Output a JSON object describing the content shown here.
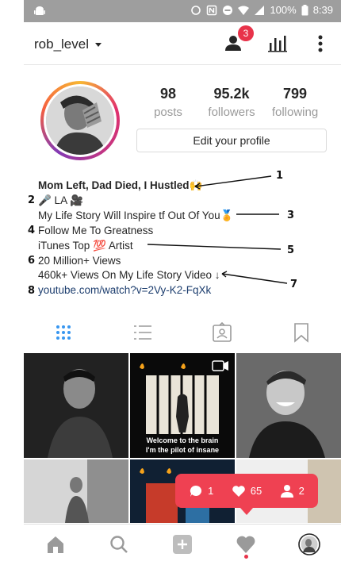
{
  "status_bar": {
    "battery": "100%",
    "time": "8:39"
  },
  "header": {
    "username": "rob_level",
    "notification_count": "3"
  },
  "profile": {
    "stats": [
      {
        "value": "98",
        "label": "posts"
      },
      {
        "value": "95.2k",
        "label": "followers"
      },
      {
        "value": "799",
        "label": "following"
      }
    ],
    "edit_button": "Edit your profile"
  },
  "bio": {
    "name": "Mom Left, Dad Died, I Hustled🙌",
    "lines": [
      "🎤 LA 🎥",
      "My Life Story Will Inspire tf Out Of You🏅",
      "Follow Me To Greatness",
      "iTunes Top 💯 Artist",
      "20 Million+ Views",
      "460k+ Views On My Life Story Video ↓"
    ],
    "link": "youtube.com/watch?v=2Vy-K2-FqXk"
  },
  "annotations": [
    "1",
    "2",
    "3",
    "4",
    "5",
    "6",
    "7",
    "8"
  ],
  "grid": {
    "tile2_caption_line1": "Welcome to the brain",
    "tile2_caption_line2": "I'm the pilot of insane"
  },
  "notification_popup": {
    "comments": "1",
    "likes": "65",
    "follows": "2"
  },
  "colors": {
    "accent_red": "#ef4152",
    "link_blue": "#1c3d6e",
    "tab_active_blue": "#3897f0"
  }
}
